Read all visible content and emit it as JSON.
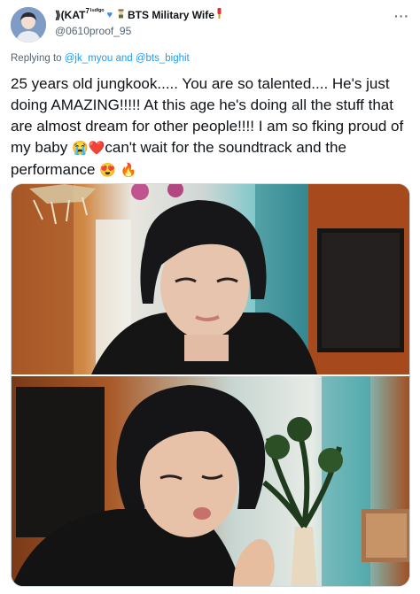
{
  "author": {
    "display_name_prefix": "⟫(KAT",
    "display_name_sup_7": "7",
    "display_name_sup_indigo": "ᴵⁿᵈⁱᵍᵒ",
    "display_name_main": "BTS Military Wife",
    "handle": "@0610proof_95"
  },
  "reply": {
    "prefix": "Replying to",
    "mention_1": "@jk_myou",
    "and": "and",
    "mention_2": "@bts_bighit"
  },
  "tweet": {
    "text_part_1": "25 years old jungkook..... You are so talented.... He's just doing AMAZING!!!!! At this age he's doing all the stuff that are almost dream for other people!!!! I am so fking proud of my baby ",
    "emoji_1": "😭",
    "emoji_2": "❤️",
    "text_part_2": "can't wait for the soundtrack and the performance ",
    "emoji_3": "😍",
    "emoji_4": "🔥"
  },
  "icons": {
    "more": "more-options-icon",
    "heart_blue": "blue-heart-icon",
    "soldier": "soldier-icon",
    "pin": "pin-icon"
  },
  "colors": {
    "link": "#1d9bf0",
    "secondary_text": "#536471",
    "primary_text": "#0f1419",
    "border": "#cfd9de"
  },
  "media": {
    "count": 2
  }
}
